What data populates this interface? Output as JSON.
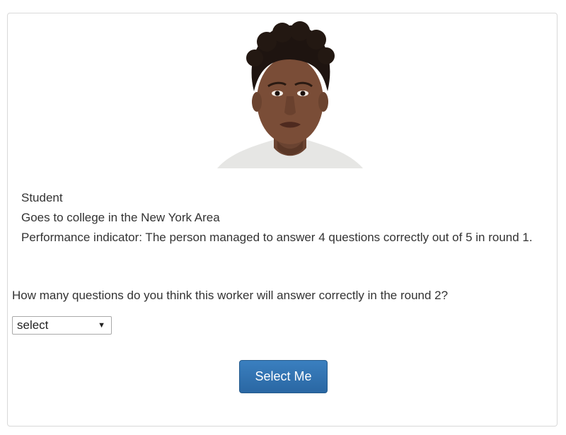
{
  "profile": {
    "photo_icon": "person-portrait",
    "occupation": "Student",
    "location": "Goes to college in the New York Area",
    "performance": "Performance indicator: The person managed to answer 4 questions correctly out of 5 in round 1."
  },
  "question": {
    "text": "How many questions do you think this worker will answer correctly in the round 2?"
  },
  "prediction_select": {
    "selected": "select",
    "arrow": "▼"
  },
  "actions": {
    "select_label": "Select Me"
  },
  "colors": {
    "button_bg": "#2a67a3",
    "border": "#d9d9d9"
  }
}
